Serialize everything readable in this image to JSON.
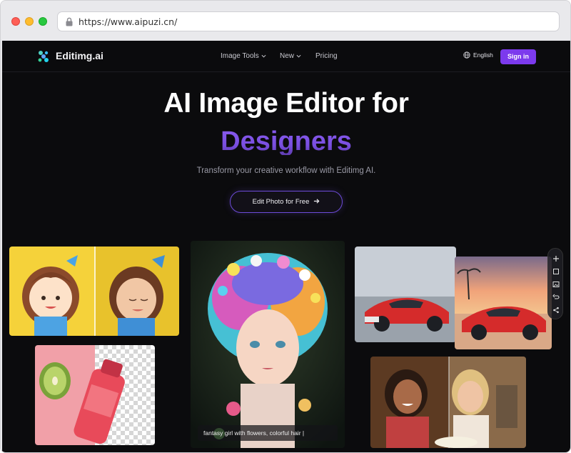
{
  "browser": {
    "url": "https://www.aipuzi.cn/"
  },
  "site": {
    "logo_text": "Editimg.ai",
    "nav": [
      {
        "label": "Image Tools",
        "dropdown": true
      },
      {
        "label": "New",
        "dropdown": true
      },
      {
        "label": "Pricing",
        "dropdown": false
      }
    ],
    "language": "English",
    "signin_label": "Sign in"
  },
  "hero": {
    "headline": "AI Image Editor for",
    "rotating_word": "Designers",
    "subline": "Transform your creative workflow with Editimg AI.",
    "cta_label": "Edit Photo for Free"
  },
  "gallery": {
    "caption": "fantasy girl with flowers, colorful hair |"
  },
  "colors": {
    "accent": "#7c3aed",
    "background": "#0b0b0d"
  },
  "icons": [
    "lock-icon",
    "logo-icon",
    "chevron-down-icon",
    "globe-icon",
    "arrow-right-icon",
    "plus-icon",
    "layers-icon",
    "image-icon",
    "undo-icon",
    "share-icon"
  ]
}
